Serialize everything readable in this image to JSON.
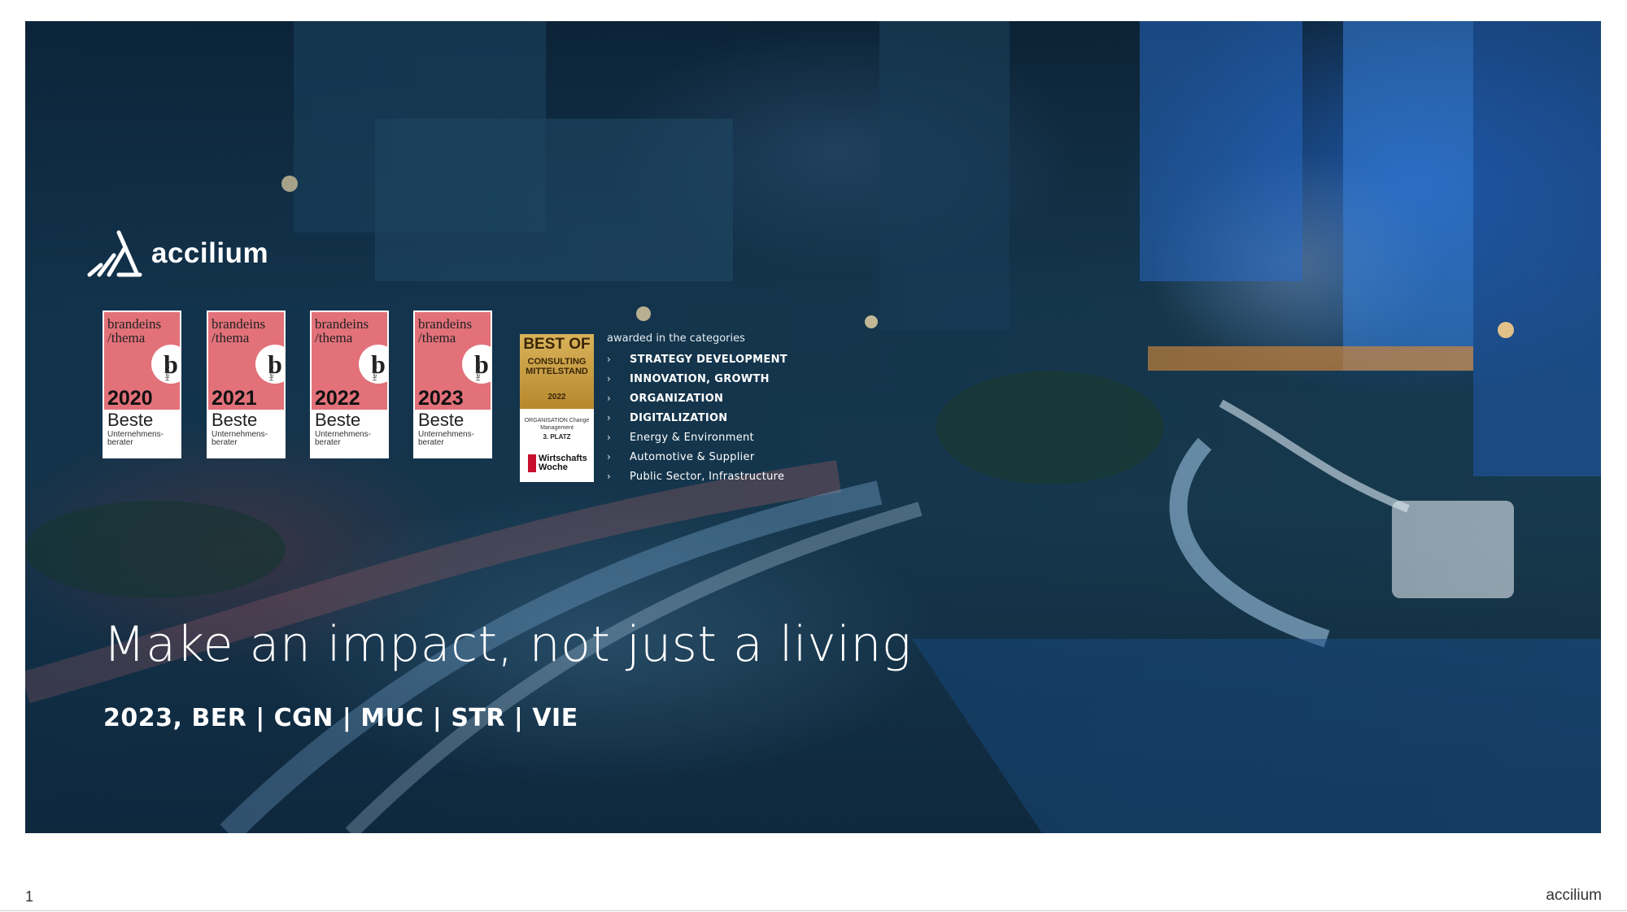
{
  "brand": {
    "name": "accilium"
  },
  "badges": [
    {
      "brand": "brandeins /thema",
      "letter": "b",
      "year": "2020",
      "best": "Beste",
      "subtitle": "Unternehmens-berater",
      "issue": "Heft 15"
    },
    {
      "brand": "brandeins /thema",
      "letter": "b",
      "year": "2021",
      "best": "Beste",
      "subtitle": "Unternehmens-berater",
      "issue": "Heft 19"
    },
    {
      "brand": "brandeins /thema",
      "letter": "b",
      "year": "2022",
      "best": "Beste",
      "subtitle": "Unternehmens-berater",
      "issue": "Heft 22"
    },
    {
      "brand": "brandeins /thema",
      "letter": "b",
      "year": "2023",
      "best": "Beste",
      "subtitle": "Unternehmens-berater",
      "issue": "Heft 25"
    }
  ],
  "gold_badge": {
    "title": "BEST OF",
    "subtitle": "CONSULTING MITTELSTAND",
    "year": "2022",
    "category": "ORGANISATION Change Management",
    "place": "3. PLATZ",
    "publisher": "Wirtschafts Woche"
  },
  "awards": {
    "intro": "awarded in the categories",
    "items": [
      {
        "label": "STRATEGY DEVELOPMENT",
        "bold": true
      },
      {
        "label": "INNOVATION, GROWTH",
        "bold": true
      },
      {
        "label": "ORGANIZATION",
        "bold": true
      },
      {
        "label": "DIGITALIZATION",
        "bold": true
      },
      {
        "label": "Energy & Environment",
        "bold": false
      },
      {
        "label": "Automotive & Supplier",
        "bold": false
      },
      {
        "label": "Public Sector, Infrastructure",
        "bold": false
      }
    ],
    "chevron": "›"
  },
  "headline": "Make an impact, not just a living",
  "locations": "2023, BER | CGN | MUC | STR | VIE",
  "footer": {
    "page_number": "1",
    "brand": "accilium"
  },
  "colors": {
    "badge_pink": "#e2717a",
    "gold": "#c89a3e",
    "slide_blue": "#17394d"
  }
}
